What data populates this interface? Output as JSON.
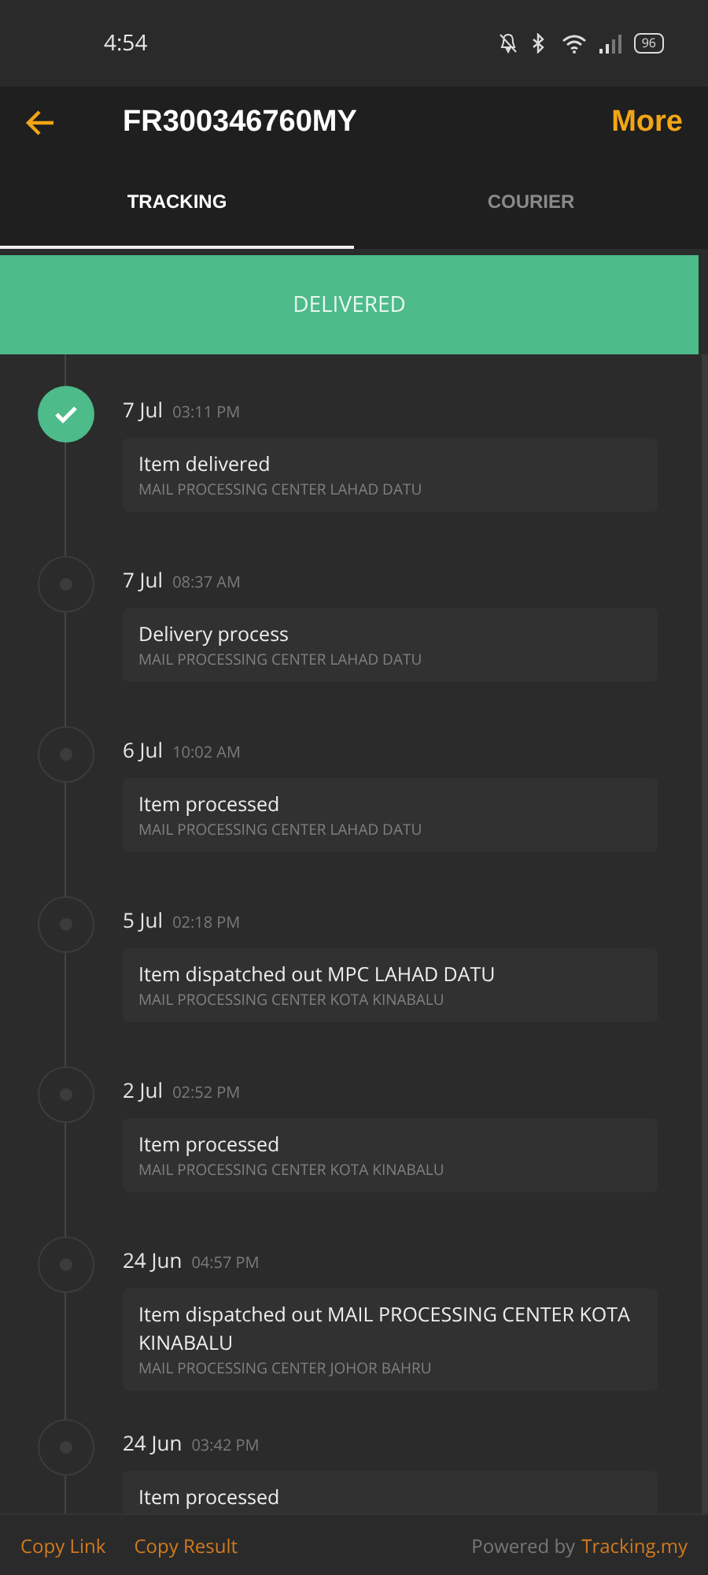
{
  "status_bar": {
    "time": "4:54",
    "battery": "96"
  },
  "header": {
    "title": "FR300346760MY",
    "action": "More"
  },
  "tabs": [
    {
      "label": "TRACKING",
      "selected": true
    },
    {
      "label": "COURIER",
      "selected": false
    }
  ],
  "banner": {
    "status": "DELIVERED"
  },
  "events": [
    {
      "date": "7 Jul",
      "time": "03:11 PM",
      "title": "Item delivered",
      "location": "MAIL PROCESSING CENTER LAHAD DATU",
      "completed": true
    },
    {
      "date": "7 Jul",
      "time": "08:37 AM",
      "title": "Delivery process",
      "location": "MAIL PROCESSING CENTER LAHAD DATU",
      "completed": false
    },
    {
      "date": "6 Jul",
      "time": "10:02 AM",
      "title": "Item processed",
      "location": "MAIL PROCESSING CENTER LAHAD DATU",
      "completed": false
    },
    {
      "date": "5 Jul",
      "time": "02:18 PM",
      "title": "Item dispatched out MPC LAHAD DATU",
      "location": "MAIL PROCESSING CENTER KOTA KINABALU",
      "completed": false
    },
    {
      "date": "2 Jul",
      "time": "02:52 PM",
      "title": "Item processed",
      "location": "MAIL PROCESSING CENTER KOTA KINABALU",
      "completed": false
    },
    {
      "date": "24 Jun",
      "time": "04:57 PM",
      "title": "Item dispatched out MAIL PROCESSING CENTER KOTA KINABALU",
      "location": "MAIL PROCESSING CENTER JOHOR BAHRU",
      "completed": false
    },
    {
      "date": "24 Jun",
      "time": "03:42 PM",
      "title": "Item processed",
      "completed": false
    }
  ],
  "footer": {
    "links": [
      "Copy Link",
      "Copy Result"
    ],
    "powered_by": "Powered by",
    "brand": "Tracking.my"
  }
}
